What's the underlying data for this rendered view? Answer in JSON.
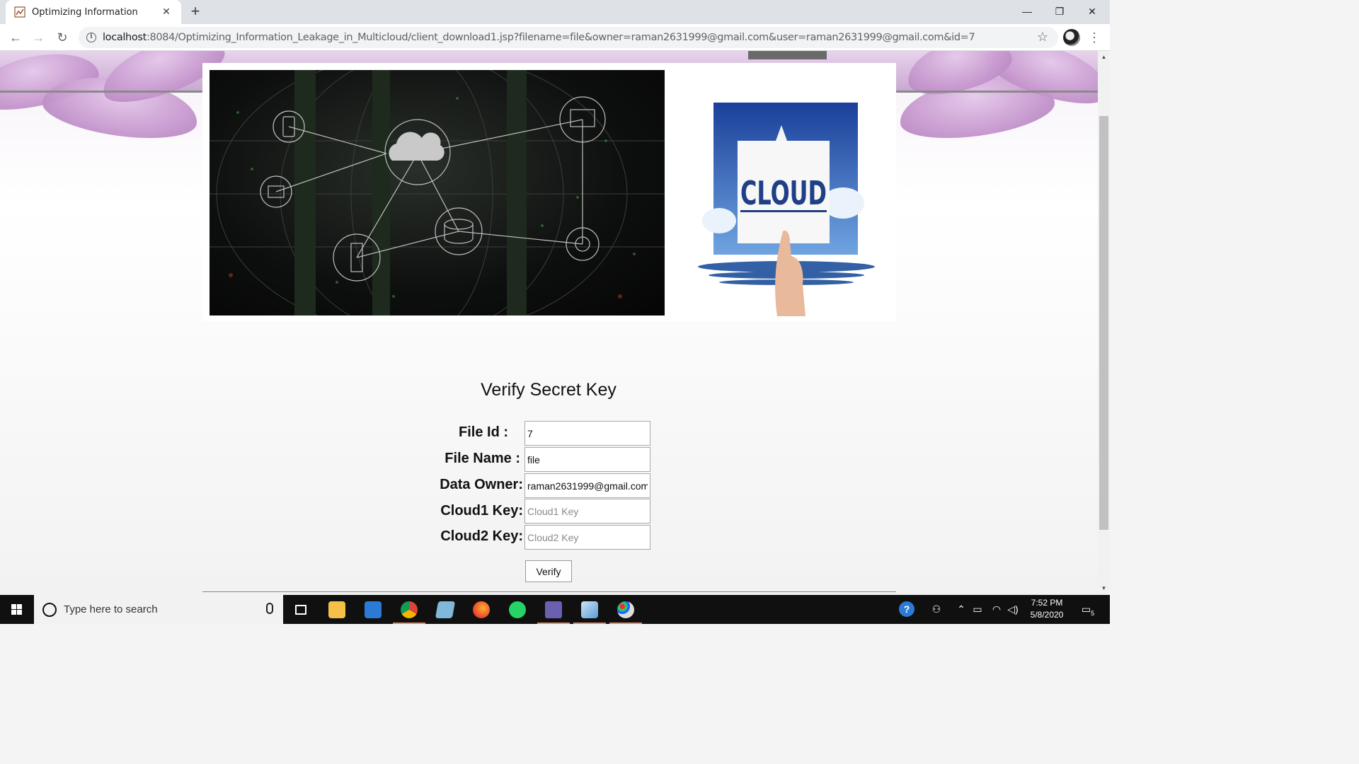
{
  "browser": {
    "tab_title": "Optimizing Information",
    "tab_close": "✕",
    "new_tab": "+",
    "url_host": "localhost",
    "url_rest": ":8084/Optimizing_Information_Leakage_in_Multicloud/client_download1.jsp?filename=file&owner=raman2631999@gmail.com&user=raman2631999@gmail.com&id=7",
    "window_controls": {
      "minimize": "—",
      "restore": "❐",
      "close": "✕"
    }
  },
  "banner": {
    "right_image_text": "CLOUD"
  },
  "form": {
    "title": "Verify Secret Key",
    "fields": [
      {
        "label": "File Id :",
        "value": "7",
        "placeholder": ""
      },
      {
        "label": "File Name :",
        "value": "file",
        "placeholder": ""
      },
      {
        "label": "Data Owner:",
        "value": "raman2631999@gmail.com",
        "placeholder": ""
      },
      {
        "label": "Cloud1 Key:",
        "value": "",
        "placeholder": "Cloud1 Key"
      },
      {
        "label": "Cloud2 Key:",
        "value": "",
        "placeholder": "Cloud2 Key"
      }
    ],
    "submit_label": "Verify"
  },
  "taskbar": {
    "search_placeholder": "Type here to search",
    "time": "7:52 PM",
    "date": "5/8/2020",
    "notification_count": "5"
  },
  "colors": {
    "header_purple": "#c8a8d0",
    "taskbar_bg": "#101010",
    "active_app_underline": "#d98a6c"
  }
}
